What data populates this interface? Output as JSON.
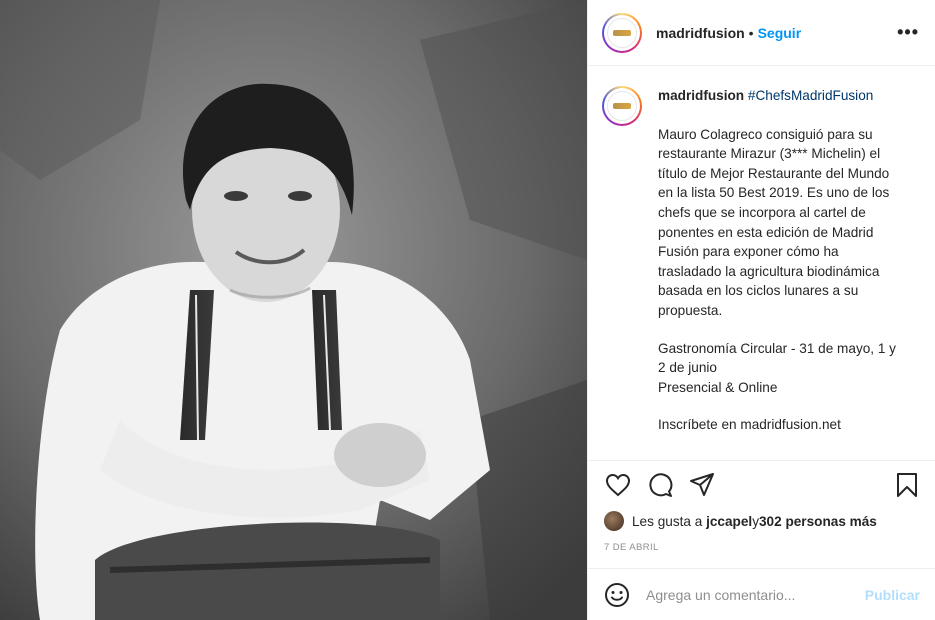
{
  "photo": {
    "alt_icon": "chef-portrait-photo"
  },
  "header": {
    "username": "madridfusion",
    "separator": "•",
    "follow_label": "Seguir",
    "more_icon": "more-options-icon",
    "more_label": "•••"
  },
  "caption": {
    "username": "madridfusion",
    "hashtag": "#ChefsMadridFusion",
    "paragraph1": "Mauro Colagreco consiguió para su restaurante Mirazur (3*** Michelin) el título de Mejor Restaurante del Mundo en la lista 50 Best 2019. Es uno de los chefs que se incorpora al cartel de ponentes en esta edición de Madrid Fusión para exponer cómo ha trasladado la agricultura biodinámica basada en los ciclos lunares a su propuesta.",
    "paragraph2": "Gastronomía Circular - 31 de mayo, 1 y 2 de junio\nPresencial & Online",
    "paragraph3": "Inscríbete en madridfusion.net"
  },
  "actions": {
    "like_icon": "heart-icon",
    "comment_icon": "comment-bubble-icon",
    "share_icon": "paper-plane-icon",
    "save_icon": "bookmark-icon"
  },
  "likes": {
    "prefix": "Les gusta a ",
    "user": "jccapel",
    "middle": " y ",
    "count": "302 personas más"
  },
  "date": "7 DE ABRIL",
  "comment": {
    "emoji_icon": "smiley-icon",
    "placeholder": "Agrega un comentario...",
    "post_label": "Publicar"
  },
  "colors": {
    "link_blue": "#0095f6",
    "hashtag_blue": "#00376b",
    "post_disabled": "#b2dffc",
    "muted_gray": "#8e8e8e"
  }
}
